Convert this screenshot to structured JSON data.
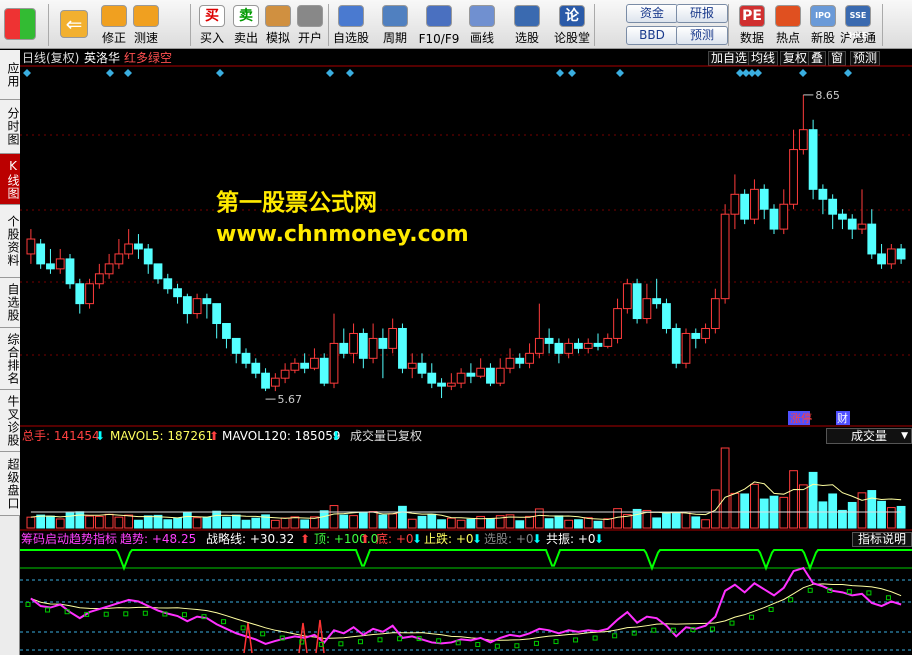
{
  "toolbar": {
    "items": [
      {
        "label": "",
        "icon": "start-icon"
      },
      {
        "label": "",
        "icon": "back-arrow-icon"
      },
      {
        "label": "修正",
        "icon": "up-down-arrow-icon"
      },
      {
        "label": "测速",
        "icon": "speed-test-icon"
      },
      {
        "label": "买入",
        "icon": "buy-icon",
        "glyph": "买"
      },
      {
        "label": "卖出",
        "icon": "sell-icon",
        "glyph": "卖"
      },
      {
        "label": "模拟",
        "icon": "hammer-icon"
      },
      {
        "label": "开户",
        "icon": "lock-icon"
      },
      {
        "label": "自选股",
        "icon": "star-icon"
      },
      {
        "label": "周期",
        "icon": "clock-icon"
      },
      {
        "label": "F10/F9",
        "icon": "window-icon"
      },
      {
        "label": "画线",
        "icon": "pen-icon"
      },
      {
        "label": "选股",
        "icon": "monitor-icon"
      },
      {
        "label": "论股堂",
        "icon": "lun-icon",
        "glyph": "论"
      },
      {
        "label": "数据",
        "icon": "pe-icon",
        "glyph": "PE"
      },
      {
        "label": "热点",
        "icon": "hot-icon"
      },
      {
        "label": "新股",
        "icon": "ipo-icon",
        "glyph": "IPO"
      },
      {
        "label": "沪港通",
        "icon": "hk-icon",
        "glyph": "SSE HKE"
      }
    ],
    "small_buttons": {
      "zijin": "资金",
      "bbd": "BBD",
      "yanbao": "研报",
      "yuce": "预测"
    }
  },
  "sidetabs": [
    "应用",
    "分时图",
    "K线图",
    "个股资料",
    "自选股",
    "综合排名",
    "牛叉诊股",
    "超级盘口"
  ],
  "chart_header": {
    "period": "日线(复权)",
    "name": "英洛华",
    "tag": "红多绿空"
  },
  "chart_buttons": [
    "加自选",
    "均线",
    "复权",
    "叠",
    "窗",
    "预测"
  ],
  "watermark": {
    "line1": "第一股票公式网",
    "line2": "www.chnmoney.com"
  },
  "markers": {
    "zhang": "涨",
    "yan": "停",
    "cai": "财"
  },
  "volume_panel": {
    "label": "总手: 141454",
    "mavol5": "MAVOL5: 187261",
    "mavol120": "MAVOL120: 185059",
    "note": "成交量已复权",
    "selector": "成交量"
  },
  "indicator_panel": {
    "name": "筹码启动趋势指标",
    "trend": "趋势: +48.25",
    "strategy": "战略线: +30.32",
    "top": "顶: +100.0",
    "bottom": "底: +0",
    "stop": "止跌: +0",
    "select": "选股: +0",
    "resonance": "共振: +0",
    "help": "指标说明"
  },
  "chart_data": {
    "type": "candlestick",
    "high_label": "8.65",
    "low_label": "5.67",
    "candles": [
      [
        7.05,
        7.2,
        7.3,
        6.95
      ],
      [
        7.15,
        6.95,
        7.2,
        6.9
      ],
      [
        6.95,
        6.9,
        7.1,
        6.85
      ],
      [
        6.9,
        7.0,
        7.1,
        6.85
      ],
      [
        7.0,
        6.75,
        7.05,
        6.7
      ],
      [
        6.75,
        6.55,
        6.8,
        6.45
      ],
      [
        6.55,
        6.75,
        6.8,
        6.5
      ],
      [
        6.75,
        6.85,
        6.95,
        6.7
      ],
      [
        6.85,
        6.95,
        7.05,
        6.8
      ],
      [
        6.95,
        7.05,
        7.2,
        6.9
      ],
      [
        7.05,
        7.15,
        7.3,
        7.0
      ],
      [
        7.15,
        7.1,
        7.25,
        7.0
      ],
      [
        7.1,
        6.95,
        7.15,
        6.85
      ],
      [
        6.95,
        6.8,
        6.95,
        6.75
      ],
      [
        6.8,
        6.7,
        6.85,
        6.65
      ],
      [
        6.7,
        6.62,
        6.75,
        6.55
      ],
      [
        6.62,
        6.45,
        6.65,
        6.35
      ],
      [
        6.45,
        6.6,
        6.65,
        6.4
      ],
      [
        6.6,
        6.55,
        6.65,
        6.4
      ],
      [
        6.55,
        6.35,
        6.55,
        6.2
      ],
      [
        6.35,
        6.2,
        6.35,
        6.1
      ],
      [
        6.2,
        6.05,
        6.2,
        5.95
      ],
      [
        6.05,
        5.95,
        6.1,
        5.9
      ],
      [
        5.95,
        5.85,
        6.0,
        5.8
      ],
      [
        5.85,
        5.7,
        5.9,
        5.67
      ],
      [
        5.72,
        5.8,
        5.85,
        5.67
      ],
      [
        5.8,
        5.88,
        5.95,
        5.75
      ],
      [
        5.88,
        5.95,
        6.0,
        5.85
      ],
      [
        5.95,
        5.9,
        6.05,
        5.85
      ],
      [
        5.9,
        6.0,
        6.1,
        5.88
      ],
      [
        6.0,
        5.75,
        6.05,
        5.72
      ],
      [
        5.75,
        6.15,
        6.45,
        5.7
      ],
      [
        6.15,
        6.05,
        6.3,
        6.0
      ],
      [
        6.05,
        6.25,
        6.35,
        5.95
      ],
      [
        6.25,
        6.0,
        6.3,
        5.9
      ],
      [
        6.0,
        6.2,
        6.35,
        5.95
      ],
      [
        6.2,
        6.1,
        6.3,
        5.8
      ],
      [
        6.1,
        6.3,
        6.4,
        6.05
      ],
      [
        6.3,
        5.9,
        6.35,
        5.85
      ],
      [
        5.9,
        5.95,
        6.05,
        5.8
      ],
      [
        5.95,
        5.85,
        6.05,
        5.8
      ],
      [
        5.85,
        5.75,
        5.95,
        5.7
      ],
      [
        5.75,
        5.72,
        5.8,
        5.6
      ],
      [
        5.72,
        5.75,
        5.85,
        5.68
      ],
      [
        5.75,
        5.85,
        5.9,
        5.7
      ],
      [
        5.85,
        5.82,
        5.95,
        5.75
      ],
      [
        5.82,
        5.9,
        6.0,
        5.8
      ],
      [
        5.9,
        5.75,
        5.95,
        5.72
      ],
      [
        5.75,
        5.9,
        6.0,
        5.72
      ],
      [
        5.9,
        6.0,
        6.1,
        5.85
      ],
      [
        6.0,
        5.95,
        6.05,
        5.9
      ],
      [
        5.95,
        6.05,
        6.15,
        5.9
      ],
      [
        6.05,
        6.2,
        6.55,
        6.0
      ],
      [
        6.2,
        6.15,
        6.3,
        6.05
      ],
      [
        6.15,
        6.05,
        6.2,
        5.95
      ],
      [
        6.05,
        6.15,
        6.2,
        6.0
      ],
      [
        6.15,
        6.1,
        6.2,
        6.05
      ],
      [
        6.1,
        6.15,
        6.2,
        6.05
      ],
      [
        6.15,
        6.12,
        6.25,
        6.08
      ],
      [
        6.12,
        6.2,
        6.25,
        6.1
      ],
      [
        6.2,
        6.5,
        6.6,
        6.15
      ],
      [
        6.5,
        6.75,
        6.8,
        6.45
      ],
      [
        6.75,
        6.4,
        6.8,
        6.35
      ],
      [
        6.4,
        6.6,
        6.75,
        6.35
      ],
      [
        6.6,
        6.55,
        6.8,
        6.5
      ],
      [
        6.55,
        6.3,
        6.6,
        6.25
      ],
      [
        6.3,
        5.95,
        6.35,
        5.9
      ],
      [
        5.95,
        6.25,
        6.3,
        5.9
      ],
      [
        6.25,
        6.2,
        6.3,
        6.1
      ],
      [
        6.2,
        6.3,
        6.35,
        6.15
      ],
      [
        6.3,
        6.6,
        6.7,
        6.25
      ],
      [
        6.6,
        7.45,
        7.55,
        6.55
      ],
      [
        7.45,
        7.65,
        7.85,
        7.3
      ],
      [
        7.65,
        7.4,
        7.7,
        7.35
      ],
      [
        7.4,
        7.7,
        7.8,
        7.35
      ],
      [
        7.7,
        7.5,
        7.75,
        7.4
      ],
      [
        7.5,
        7.3,
        7.55,
        7.25
      ],
      [
        7.3,
        7.55,
        7.7,
        7.25
      ],
      [
        7.55,
        8.1,
        8.3,
        7.5
      ],
      [
        8.1,
        8.3,
        8.65,
        8.05
      ],
      [
        8.3,
        7.7,
        8.4,
        7.6
      ],
      [
        7.7,
        7.6,
        7.75,
        7.45
      ],
      [
        7.6,
        7.45,
        7.65,
        7.3
      ],
      [
        7.45,
        7.4,
        7.5,
        7.3
      ],
      [
        7.4,
        7.3,
        7.45,
        7.2
      ],
      [
        7.3,
        7.35,
        7.7,
        7.25
      ],
      [
        7.35,
        7.05,
        7.5,
        7.0
      ],
      [
        7.05,
        6.95,
        7.15,
        6.9
      ],
      [
        6.95,
        7.1,
        7.15,
        6.9
      ],
      [
        7.1,
        7.0,
        7.15,
        6.95
      ]
    ]
  }
}
